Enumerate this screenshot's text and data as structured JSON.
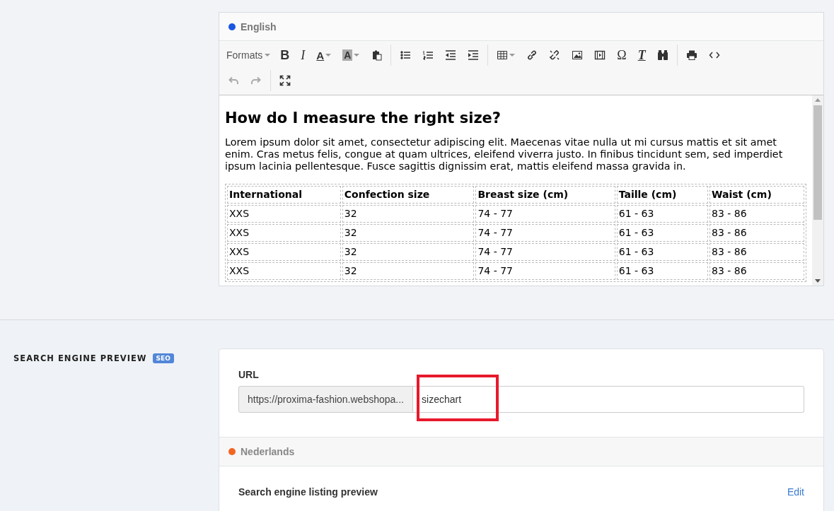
{
  "editor": {
    "language": {
      "name": "English",
      "color": "#1a56e0"
    },
    "toolbar": {
      "formats": "Formats",
      "rows": [
        [
          [
            {
              "kind": "bold",
              "label": "B",
              "dropdown": false
            },
            {
              "kind": "italic",
              "label": "I",
              "dropdown": false
            },
            {
              "kind": "text-color",
              "label": "A",
              "dropdown": true
            },
            {
              "kind": "highlight",
              "label": "A",
              "dropdown": true
            },
            {
              "kind": "paste"
            }
          ],
          [
            {
              "kind": "bullets"
            },
            {
              "kind": "numbers"
            },
            {
              "kind": "outdent"
            },
            {
              "kind": "indent"
            }
          ],
          [
            {
              "kind": "table",
              "dropdown": true
            },
            {
              "kind": "link"
            },
            {
              "kind": "unlink"
            },
            {
              "kind": "image"
            },
            {
              "kind": "media"
            },
            {
              "kind": "symbol",
              "label": "Ω"
            },
            {
              "kind": "clear-format",
              "label": "T"
            },
            {
              "kind": "find"
            }
          ],
          [
            {
              "kind": "print"
            },
            {
              "kind": "code"
            }
          ]
        ],
        [
          [
            {
              "kind": "undo",
              "disabled": true
            },
            {
              "kind": "redo",
              "disabled": true
            }
          ],
          [
            {
              "kind": "fullscreen"
            }
          ]
        ]
      ]
    },
    "heading": "How do I measure the right size?",
    "paragraph": "Lorem ipsum dolor sit amet, consectetur adipiscing elit. Maecenas vitae nulla ut mi cursus mattis et sit amet enim. Cras metus felis, congue at quam ultrices, eleifend viverra justo. In finibus tincidunt sem, sed imperdiet ipsum lacinia pellentesque. Fusce sagittis dignissim erat, mattis eleifend massa gravida in.",
    "table": {
      "columns": [
        "International",
        "Confection size",
        "Breast size (cm)",
        "Taille (cm)",
        "Waist (cm)"
      ],
      "rows": [
        [
          "XXS",
          "32",
          "74 - 77",
          "61 - 63",
          "83 - 86"
        ],
        [
          "XXS",
          "32",
          "74 - 77",
          "61 - 63",
          "83 - 86"
        ],
        [
          "XXS",
          "32",
          "74 - 77",
          "61 - 63",
          "83 - 86"
        ],
        [
          "XXS",
          "32",
          "74 - 77",
          "61 - 63",
          "83 - 86"
        ]
      ]
    }
  },
  "seo": {
    "title": "SEARCH ENGINE PREVIEW",
    "badge": "SEO",
    "url": {
      "label": "URL",
      "prefix": "https://proxima-fashion.webshopa...",
      "value": "sizechart",
      "highlighted": true
    },
    "language": {
      "name": "Nederlands",
      "color": "#f26522"
    },
    "preview_title": "Search engine listing preview",
    "edit_link": "Edit"
  }
}
